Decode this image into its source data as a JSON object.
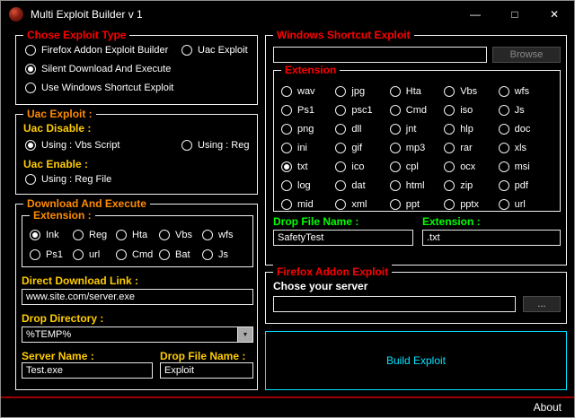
{
  "window": {
    "title": "Multi Exploit Builder v 1"
  },
  "icons": {
    "minimize": "—",
    "maximize": "□",
    "close": "✕",
    "dropdown": "▼"
  },
  "exploit_type": {
    "title": "Chose Exploit Type",
    "options": [
      {
        "label": "Firefox Addon Exploit Builder",
        "checked": false
      },
      {
        "label": "Uac Exploit",
        "checked": false
      },
      {
        "label": "Silent Download And Execute",
        "checked": true
      },
      {
        "label": "Use Windows Shortcut Exploit",
        "checked": false
      }
    ]
  },
  "uac": {
    "title": "Uac Exploit :",
    "disable_label": "Uac Disable :",
    "enable_label": "Uac Enable :",
    "options": [
      {
        "label": "Using : Vbs Script",
        "checked": true
      },
      {
        "label": "Using : Reg",
        "checked": false
      },
      {
        "label": "Using : Reg File",
        "checked": false
      }
    ]
  },
  "download_execute": {
    "title": "Download And Execute",
    "extension": {
      "title": "Extension :",
      "options": [
        {
          "label": "Ink",
          "checked": true
        },
        {
          "label": "Reg",
          "checked": false
        },
        {
          "label": "Hta",
          "checked": false
        },
        {
          "label": "Vbs",
          "checked": false
        },
        {
          "label": "wfs",
          "checked": false
        },
        {
          "label": "Ps1",
          "checked": false
        },
        {
          "label": "url",
          "checked": false
        },
        {
          "label": "Cmd",
          "checked": false
        },
        {
          "label": "Bat",
          "checked": false
        },
        {
          "label": "Js",
          "checked": false
        }
      ]
    },
    "direct_link_label": "Direct Download Link :",
    "direct_link_value": "www.site.com/server.exe",
    "drop_directory_label": "Drop Directory :",
    "drop_directory_value": "%TEMP%",
    "server_name_label": "Server Name :",
    "server_name_value": "Test.exe",
    "drop_file_label": "Drop File Name :",
    "drop_file_value": "Exploit"
  },
  "shortcut": {
    "title": "Windows Shortcut Exploit",
    "target_path_value": "",
    "browse_label": "Browse",
    "extension": {
      "title": "Extension",
      "options": [
        {
          "label": "wav",
          "checked": false
        },
        {
          "label": "jpg",
          "checked": false
        },
        {
          "label": "Hta",
          "checked": false
        },
        {
          "label": "Vbs",
          "checked": false
        },
        {
          "label": "wfs",
          "checked": false
        },
        {
          "label": "Ps1",
          "checked": false
        },
        {
          "label": "psc1",
          "checked": false
        },
        {
          "label": "Cmd",
          "checked": false
        },
        {
          "label": "iso",
          "checked": false
        },
        {
          "label": "Js",
          "checked": false
        },
        {
          "label": "png",
          "checked": false
        },
        {
          "label": "dll",
          "checked": false
        },
        {
          "label": "jnt",
          "checked": false
        },
        {
          "label": "hlp",
          "checked": false
        },
        {
          "label": "doc",
          "checked": false
        },
        {
          "label": "ini",
          "checked": false
        },
        {
          "label": "gif",
          "checked": false
        },
        {
          "label": "mp3",
          "checked": false
        },
        {
          "label": "rar",
          "checked": false
        },
        {
          "label": "xls",
          "checked": false
        },
        {
          "label": "txt",
          "checked": true
        },
        {
          "label": "ico",
          "checked": false
        },
        {
          "label": "cpl",
          "checked": false
        },
        {
          "label": "ocx",
          "checked": false
        },
        {
          "label": "msi",
          "checked": false
        },
        {
          "label": "log",
          "checked": false
        },
        {
          "label": "dat",
          "checked": false
        },
        {
          "label": "html",
          "checked": false
        },
        {
          "label": "zip",
          "checked": false
        },
        {
          "label": "pdf",
          "checked": false
        },
        {
          "label": "mid",
          "checked": false
        },
        {
          "label": "xml",
          "checked": false
        },
        {
          "label": "ppt",
          "checked": false
        },
        {
          "label": "pptx",
          "checked": false
        },
        {
          "label": "url",
          "checked": false
        }
      ]
    },
    "drop_file_label": "Drop File Name :",
    "drop_file_value": "SafetyTest",
    "extension_label": "Extension :",
    "extension_value": ".txt"
  },
  "firefox": {
    "title": "Firefox Addon Exploit",
    "server_label": "Chose your server",
    "server_value": "",
    "browse_label": "..."
  },
  "build_label": "Build Exploit",
  "footer": {
    "about": "About"
  },
  "colors": {
    "accent_red": "#ff0000",
    "accent_orange": "#ff8c00",
    "accent_yellow": "#ffcc00",
    "accent_green": "#00ff00",
    "accent_cyan": "#00e5ff",
    "separator_red": "#9e0000"
  }
}
